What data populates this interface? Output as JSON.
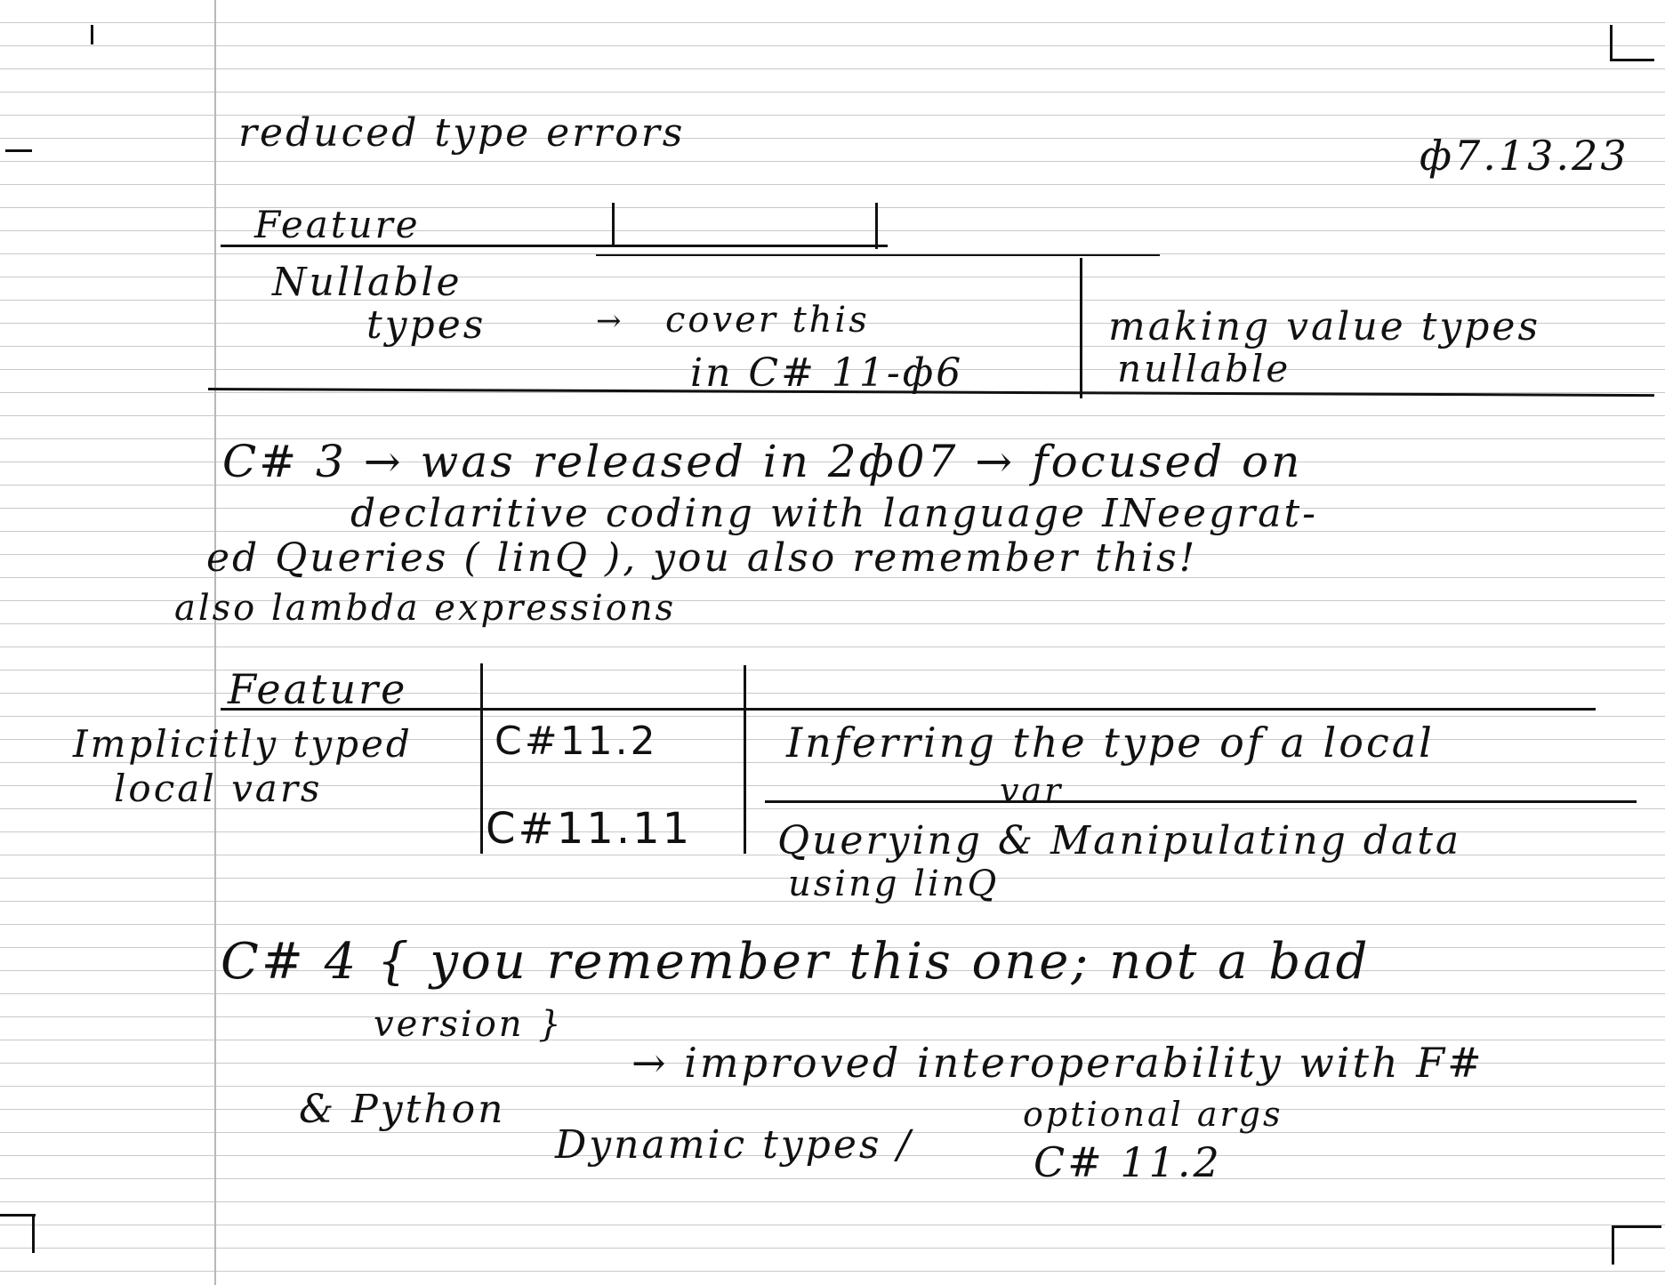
{
  "header": {
    "title": "reduced type errors",
    "date": "ф7.13.23"
  },
  "table1": {
    "header": "Feature",
    "row_feature_line1": "Nullable",
    "row_feature_line2": "types",
    "row_arrow": "→",
    "row_version_line1": "cover this",
    "row_version_line2": "in C# 11-ф6",
    "row_desc_line1": "making value types",
    "row_desc_line2": "nullable"
  },
  "csharp3": {
    "line1": "C# 3 → was released in 2ф07 → focused on",
    "line2": "declaritive coding with language INeegrat-",
    "line3": "ed Queries ( linQ ), you also remember this!",
    "line4": "also lambda expressions"
  },
  "table2": {
    "header": "Feature",
    "row1_feature_line1": "Implicitly typed",
    "row1_feature_line2": "local vars",
    "row1_version": "C#11.2",
    "row1_desc_line1": "Inferring the type of a local",
    "row1_desc_line2": "var",
    "row2_version": "C#11.11",
    "row2_desc_line1": "Querying & Manipulating data",
    "row2_desc_line2": "using linQ"
  },
  "csharp4": {
    "line1": "C# 4 { you remember this one; not a bad",
    "line2": "version }",
    "line3": "→ improved interoperability with F#",
    "line4": "& Python",
    "line5_a": "Dynamic types /",
    "line5_b": "optional args",
    "line5_c": "C# 11.2"
  }
}
